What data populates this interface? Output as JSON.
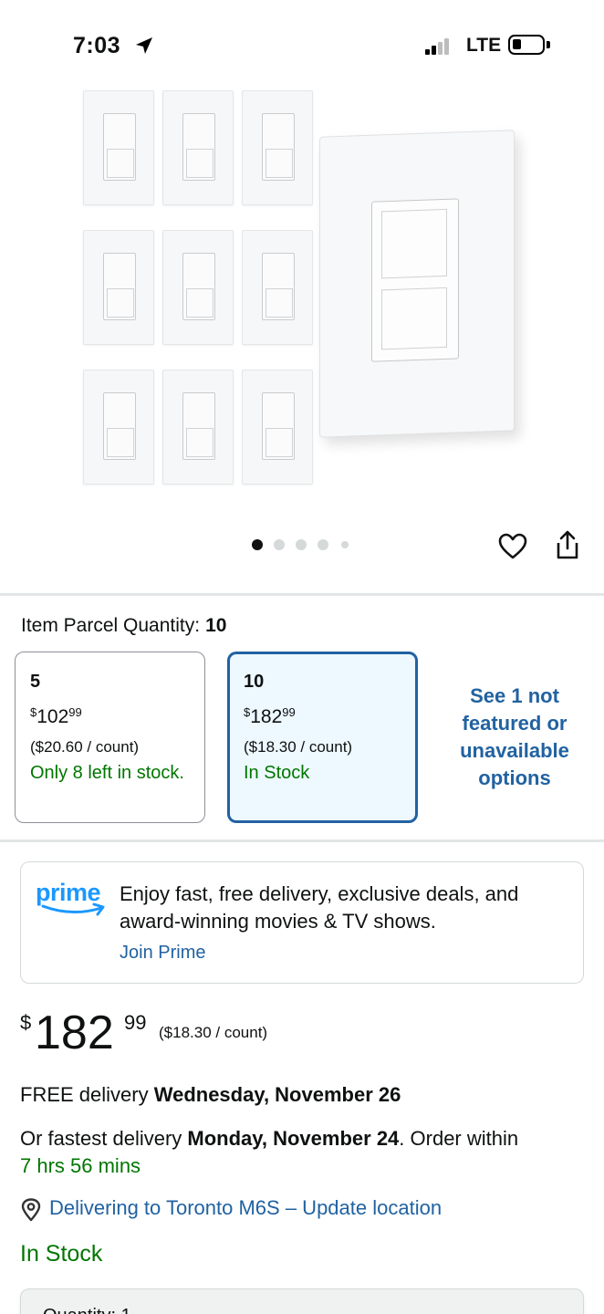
{
  "status_bar": {
    "time": "7:03",
    "network": "LTE"
  },
  "product": {
    "image_alt": "Smart dimmer switch 10-pack",
    "carousel": {
      "total": 5,
      "active": 0
    }
  },
  "quantity": {
    "label": "Item Parcel Quantity:",
    "selected": "10",
    "options": [
      {
        "count": "5",
        "currency": "$",
        "whole": "102",
        "cents": "99",
        "unit_price": "($20.60 / count)",
        "stock": "Only 8 left in stock.",
        "selected": false
      },
      {
        "count": "10",
        "currency": "$",
        "whole": "182",
        "cents": "99",
        "unit_price": "($18.30 / count)",
        "stock": "In Stock",
        "selected": true
      }
    ],
    "see_more": "See 1 not featured or unavailable options"
  },
  "prime": {
    "logo_text": "prime",
    "message": "Enjoy fast, free delivery, exclusive deals, and award-winning movies & TV shows.",
    "join": "Join Prime"
  },
  "price": {
    "currency": "$",
    "whole": "182",
    "cents": "99",
    "unit": "($18.30 / count)"
  },
  "delivery": {
    "free_prefix": "FREE delivery",
    "free_date": "Wednesday, November 26",
    "fast_prefix": "Or fastest delivery",
    "fast_date": "Monday, November 24",
    "fast_suffix": ". Order within",
    "countdown": "7 hrs 56 mins",
    "location": "Delivering to Toronto M6S – Update location"
  },
  "stock_status": "In Stock",
  "quantity_select": {
    "label": "Quantity: 1"
  },
  "colors": {
    "link": "#2162a1",
    "stock": "#007600",
    "selected_border": "#2162a1",
    "prime": "#1a98ff"
  }
}
